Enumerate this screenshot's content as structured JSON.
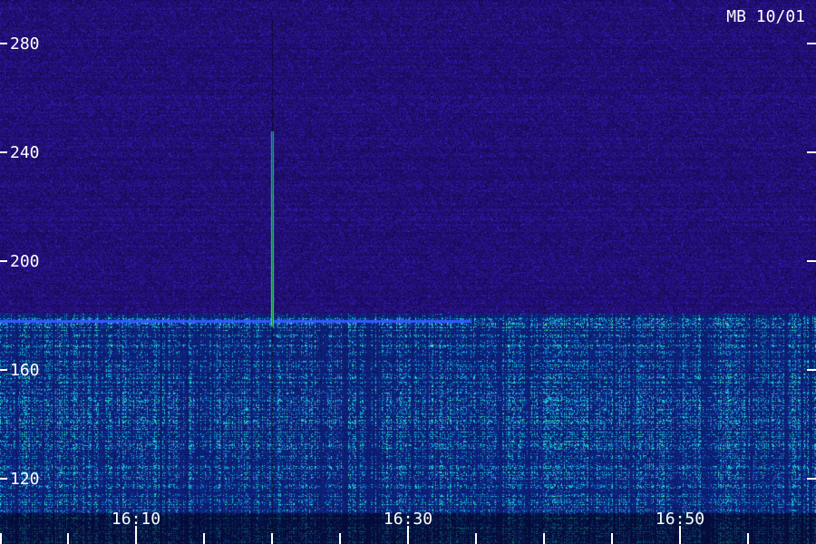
{
  "chart_data": {
    "type": "heatmap",
    "title": "MB 10/01",
    "y_ticks": [
      120,
      160,
      200,
      240,
      280
    ],
    "ylim": [
      110,
      290
    ],
    "x_ticks": [
      "16:10",
      "16:30",
      "16:50"
    ],
    "x_tick_minutes": [
      10,
      30,
      50
    ],
    "xlim_minutes": [
      0,
      59
    ],
    "minor_ticks_minutes": [
      0,
      5,
      10,
      15,
      20,
      25,
      30,
      35,
      40,
      45,
      50,
      55
    ],
    "colors": {
      "background": "#1c0e6e",
      "low": "#1a2aa8",
      "mid": "#1ec8d8",
      "high": "#39e07a",
      "text": "#ffffff"
    },
    "features": {
      "strong_band_ylim": [
        110,
        178
      ],
      "horizontal_line_y": 178,
      "vertical_burst_minute": 20,
      "vertical_burst_ylim": [
        176,
        248
      ]
    }
  }
}
